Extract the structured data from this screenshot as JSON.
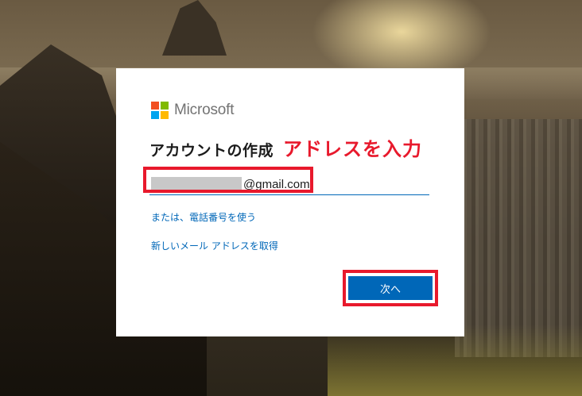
{
  "brand": {
    "name": "Microsoft",
    "logo_colors": [
      "#f25022",
      "#7fba00",
      "#00a4ef",
      "#ffb900"
    ]
  },
  "dialog": {
    "title": "アカウントの作成",
    "annotation": "アドレスを入力",
    "email": {
      "value": "@gmail.com"
    },
    "links": {
      "use_phone": "または、電話番号を使う",
      "new_address": "新しいメール アドレスを取得"
    },
    "next_button": "次へ"
  },
  "colors": {
    "accent": "#0067b8",
    "highlight": "#e8192c"
  }
}
